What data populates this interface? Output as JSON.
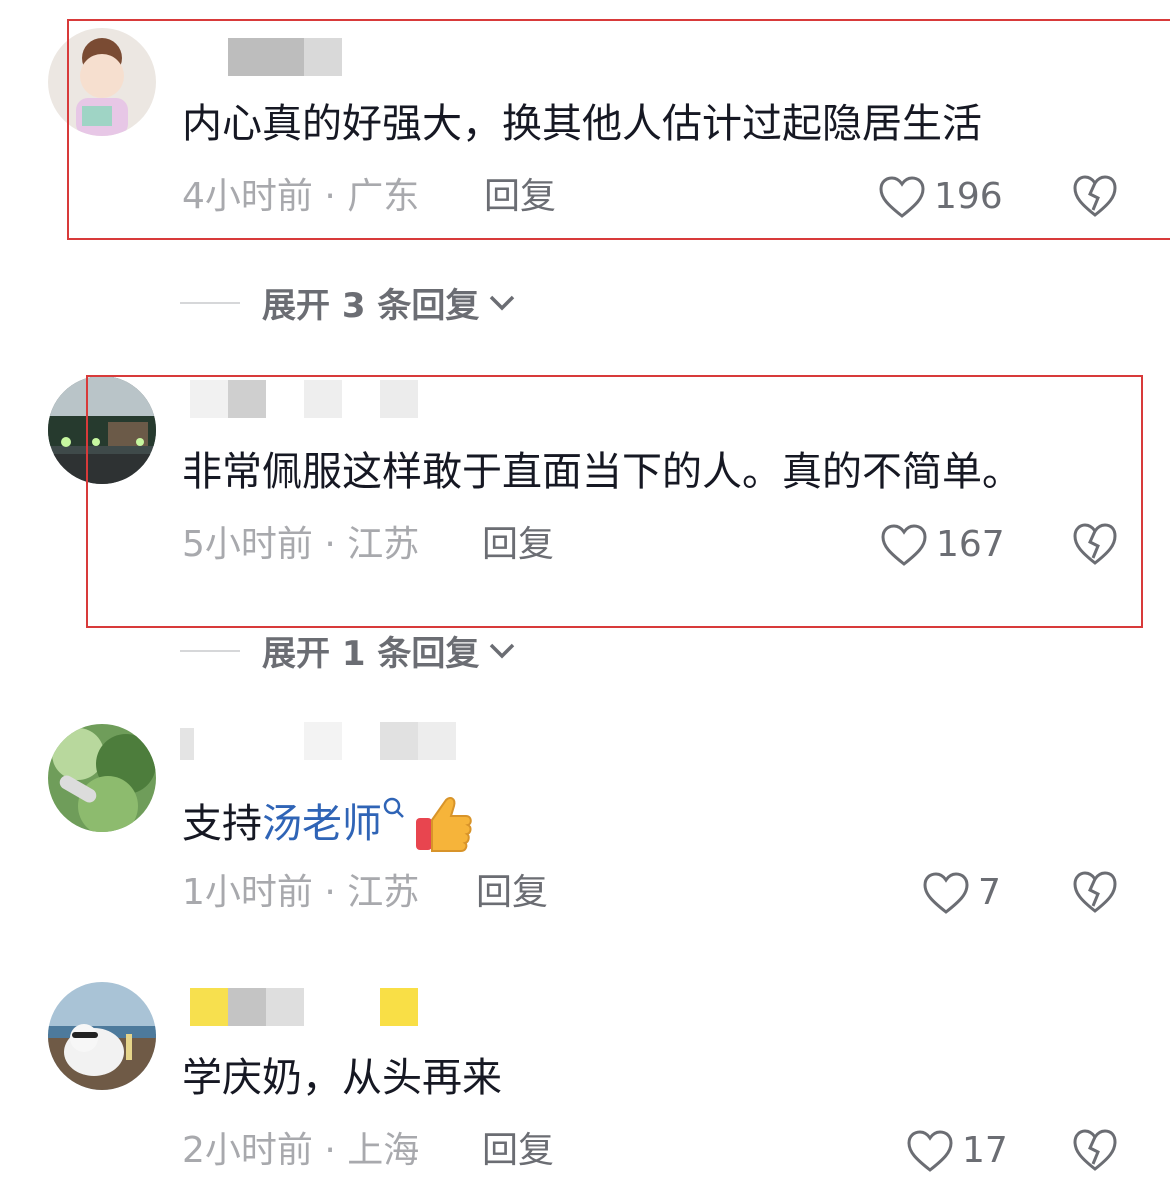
{
  "colors": {
    "accent_red": "#d83a3a",
    "mention_blue": "#2f64b6",
    "meta_gray": "#a8a9ad"
  },
  "comments": [
    {
      "text": "内心真的好强大，换其他人估计过起隐居生活",
      "time_location": "4小时前 · 广东",
      "reply_label": "回复",
      "likes": "196",
      "expand_label": "展开 3 条回复",
      "highlighted": true
    },
    {
      "text": "非常佩服这样敢于直面当下的人。真的不简单。",
      "time_location": "5小时前 · 江苏",
      "reply_label": "回复",
      "likes": "167",
      "expand_label": "展开 1 条回复",
      "highlighted": true
    },
    {
      "text_prefix": "支持",
      "mention": "汤老师",
      "mention_icon": "search-icon",
      "emoji": "thumbs-up-emoji",
      "time_location": "1小时前 · 江苏",
      "reply_label": "回复",
      "likes": "7",
      "highlighted": false
    },
    {
      "text": "学庆奶，从头再来",
      "time_location": "2小时前 · 上海",
      "reply_label": "回复",
      "likes": "17",
      "highlighted": false
    }
  ],
  "icons": {
    "like": "heart-outline-icon",
    "dislike": "broken-heart-icon",
    "expand": "chevron-down-icon"
  }
}
